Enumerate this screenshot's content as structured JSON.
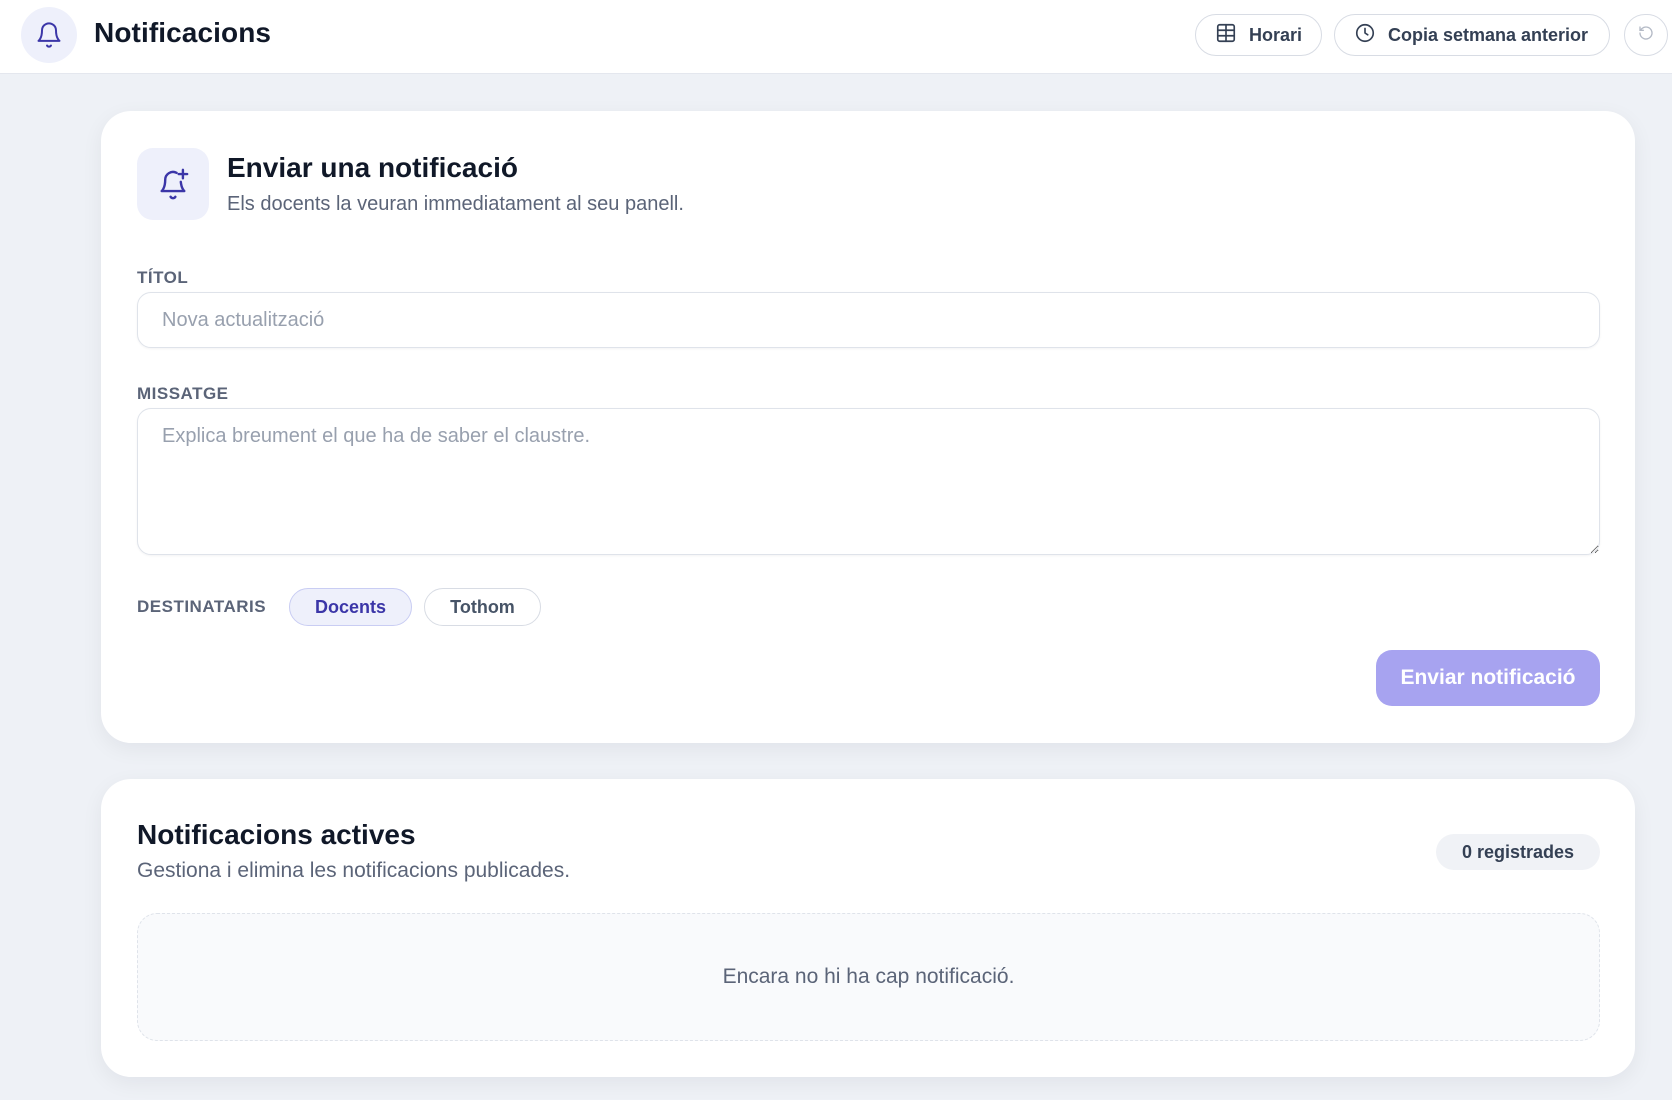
{
  "header": {
    "title": "Notificacions",
    "icon": "bell-icon",
    "buttons": {
      "schedule_label": "Horari",
      "schedule_icon": "grid-table-icon",
      "copy_label": "Copia setmana anterior",
      "copy_icon": "clock-icon",
      "undo_icon": "undo-icon"
    }
  },
  "compose": {
    "icon": "bell-plus-icon",
    "title": "Enviar una notificació",
    "subtitle": "Els docents la veuran immediatament al seu panell.",
    "title_field": {
      "label": "TÍTOL",
      "value": "",
      "placeholder": "Nova actualització"
    },
    "message_field": {
      "label": "MISSATGE",
      "value": "",
      "placeholder": "Explica breument el que ha de saber el claustre."
    },
    "recipients": {
      "label": "DESTINATARIS",
      "options": [
        "Docents",
        "Tothom"
      ],
      "selected": "Docents"
    },
    "send_label": "Enviar notificació"
  },
  "active": {
    "title": "Notificacions actives",
    "subtitle": "Gestiona i elimina les notificacions publicades.",
    "count_label": "0 registrades",
    "empty_message": "Encara no hi ha cap notificació."
  },
  "colors": {
    "accent": "#4b44c6",
    "accent_soft": "#eef0fb",
    "send_button": "#a7a3f0",
    "page_background": "#eef1f6"
  }
}
